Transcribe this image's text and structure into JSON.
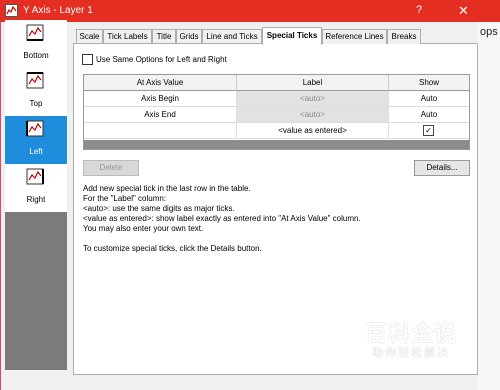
{
  "window": {
    "title": "Y Axis - Layer 1",
    "help": "?",
    "close": "✕",
    "ext_text": "ops"
  },
  "sidebar": {
    "items": [
      {
        "label": "Bottom"
      },
      {
        "label": "Top"
      },
      {
        "label": "Left"
      },
      {
        "label": "Right"
      }
    ],
    "selected": "Left"
  },
  "tabs": [
    "Scale",
    "Tick Labels",
    "Title",
    "Grids",
    "Line and Ticks",
    "Special Ticks",
    "Reference Lines",
    "Breaks"
  ],
  "active_tab": "Special Ticks",
  "options": {
    "same_options_label": "Use Same Options for Left and Right",
    "same_options_checked": false
  },
  "table": {
    "headers": [
      "At Axis Value",
      "Label",
      "Show"
    ],
    "rows": [
      [
        "Axis Begin",
        "<auto>",
        "Auto"
      ],
      [
        "Axis End",
        "<auto>",
        "Auto"
      ],
      [
        "",
        "<value as entered>",
        "✓"
      ]
    ]
  },
  "buttons": {
    "delete": "Delete",
    "details": "Details..."
  },
  "description": [
    "Add new special tick in the last row in the table.",
    "For the \"Label\" column:",
    "<auto>: use the same digits as major ticks.",
    "<value as entered>: show label exactly as entered into \"At Axis Value\" column.",
    "You may also enter your own text.",
    "",
    "To customize special ticks, click the Details button."
  ],
  "watermark": {
    "main": "百科全说",
    "sub": "助你轻松解决"
  },
  "colors": {
    "titlebar": "#e52e22",
    "selected": "#1e8ddb",
    "sidebar_bg": "#7b7b7b"
  }
}
